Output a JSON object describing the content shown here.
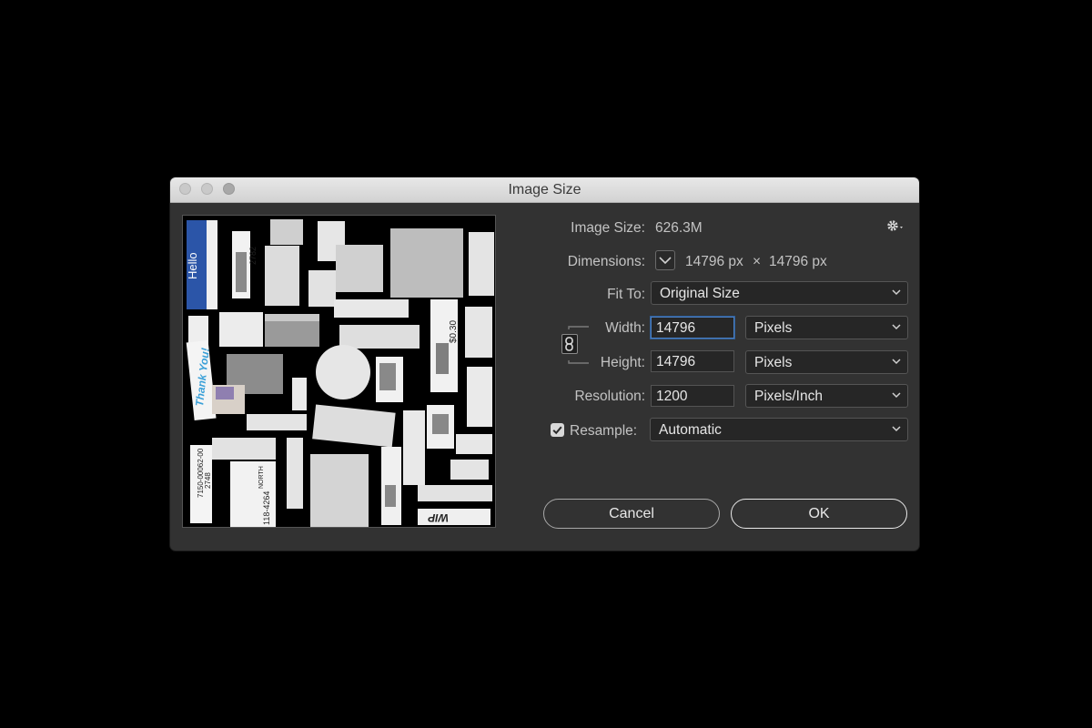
{
  "window": {
    "title": "Image Size"
  },
  "info": {
    "image_size_label": "Image Size:",
    "image_size_value": "626.3M",
    "dimensions_label": "Dimensions:",
    "dimensions_width": "14796 px",
    "dimensions_x": "×",
    "dimensions_height": "14796 px"
  },
  "fit_to": {
    "label": "Fit To:",
    "value": "Original Size"
  },
  "width": {
    "label": "Width:",
    "value": "14796",
    "unit": "Pixels"
  },
  "height": {
    "label": "Height:",
    "value": "14796",
    "unit": "Pixels"
  },
  "resolution": {
    "label": "Resolution:",
    "value": "1200",
    "unit": "Pixels/Inch"
  },
  "resample": {
    "label": "Resample:",
    "checked": true,
    "value": "Automatic"
  },
  "buttons": {
    "cancel": "Cancel",
    "ok": "OK"
  },
  "preview": {
    "hello_text": "Hello",
    "thanks_text": "Thank You!",
    "price_text": "$0.30",
    "wip_text": "WIP",
    "code_top": "2782",
    "code_left": "2748",
    "code_bottom": "118-4264",
    "code_side": "NORTH",
    "code_mid": "7150-00062-00"
  },
  "colors": {
    "accent_focus": "#4d7fbf",
    "hello_blue": "#2b55a8",
    "thanks_blue": "#3aa0d8"
  }
}
